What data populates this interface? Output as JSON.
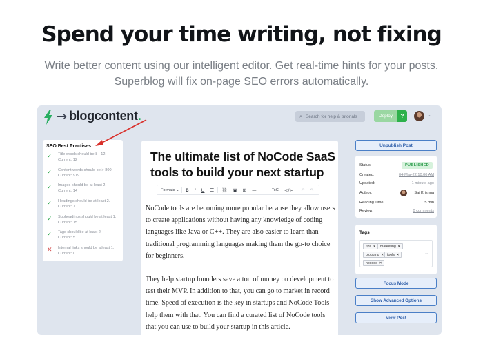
{
  "hero": {
    "title": "Spend your time writing, not fixing",
    "subtitle_line1": "Write better content using our intelligent editor. Get real-time hints for your posts.",
    "subtitle_line2": "Superblog will fix on-page SEO errors automatically."
  },
  "topbar": {
    "logo_text": "blogcontent",
    "logo_dot": ".",
    "logo_arrow": "→",
    "search_placeholder": "Search for help & tutorials",
    "deploy_label": "Deploy",
    "help_label": "?",
    "avatar_chevron": "⌄",
    "brand_color": "#27ae60"
  },
  "seo": {
    "title": "SEO Best Practises",
    "items": [
      {
        "status": "ok",
        "mark": "✓",
        "line1": "Title words should be 8 - 12",
        "line2": "Current: 12"
      },
      {
        "status": "ok",
        "mark": "✓",
        "line1": "Content words should be > 800",
        "line2": "Current: 919"
      },
      {
        "status": "ok",
        "mark": "✓",
        "line1": "Images should be at least 2",
        "line2": "Current: 14"
      },
      {
        "status": "ok",
        "mark": "✓",
        "line1": "Headings should be at least 2.",
        "line2": "Current: 7"
      },
      {
        "status": "ok",
        "mark": "✓",
        "line1": "Subheadings should be at least 1.",
        "line2": "Current: 15"
      },
      {
        "status": "ok",
        "mark": "✓",
        "line1": "Tags should be at least 2.",
        "line2": "Current: 5"
      },
      {
        "status": "bad",
        "mark": "✕",
        "line1": "Internal links should be atleast 1.",
        "line2": "Current: 0"
      }
    ]
  },
  "editor": {
    "title": "The ultimate list of NoCode SaaS tools to build your next startup",
    "toolbar": {
      "formats": "Formats",
      "formats_chevron": "⌄",
      "bold": "B",
      "italic": "I",
      "underline": "U",
      "list": "☰",
      "link": "🔗",
      "image": "▣",
      "table": "⊞",
      "hr": "—",
      "more": "···",
      "toc": "ToC",
      "code": "</>",
      "undo": "↶",
      "redo": "↷"
    },
    "paragraphs": [
      "NoCode tools are becoming more popular because they allow users to create applications without having any knowledge of coding languages like Java or C++. They are also easier to learn than traditional programming languages making them the go-to choice for beginners.",
      "They help startup founders save a ton of money on development to test their MVP. In addition to that, you can go to market in record time. Speed of execution is the key in startups and NoCode Tools help them with that. You can find a curated list of NoCode tools that you can use to build your startup in this article."
    ]
  },
  "sidebar": {
    "unpublish_label": "Unpublish Post",
    "meta": {
      "status_label": "Status:",
      "status_value": "PUBLISHED",
      "created_label": "Created:",
      "created_value": "04-Mar-22 10:00 AM",
      "updated_label": "Updated:",
      "updated_value": "1 minute ago",
      "author_label": "Author:",
      "author_value": "Sai Krishna",
      "reading_label": "Reading Time:",
      "reading_value": "5 min",
      "review_label": "Review:",
      "review_value": "0 comments"
    },
    "tags": {
      "title": "Tags",
      "items": [
        "tips",
        "marketing",
        "blogging",
        "tools",
        "nocode"
      ],
      "remove_mark": "×",
      "chevron": "⌄"
    },
    "focus_label": "Focus Mode",
    "advanced_label": "Show Advanced Options",
    "view_label": "View Post"
  }
}
